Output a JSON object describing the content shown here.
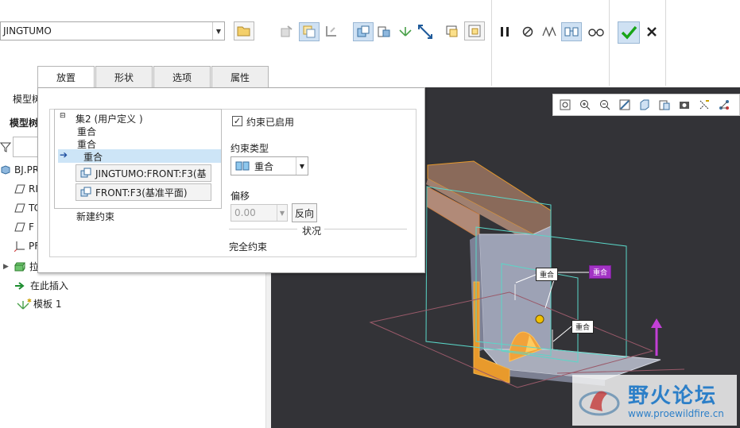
{
  "colors": {
    "accent_blue": "#2c7fc8",
    "viewport_bg": "#333337",
    "selection_bg": "#cde5f7",
    "orange_surface": "#e89a2c",
    "teal_outline": "#5ad7c8",
    "purple_tag": "#a233c4",
    "confirm_green": "#18a518"
  },
  "ribbon": {
    "template_combo": {
      "value": "JINGTUMO"
    },
    "icons": [
      "open-folder-icon",
      "component-interface-icon",
      "assembly-icon",
      "copy-placement-icon",
      "user-defined-icon",
      "package-icon",
      "mechanism-icon",
      "move-drag-icon",
      "show-component-icon",
      "separate-window-icon",
      "pause-icon",
      "cancel-circle-icon",
      "preview-icon",
      "check-glasses-icon",
      "view-glasses-icon",
      "confirm-check-icon",
      "close-x-icon"
    ]
  },
  "tabs": [
    {
      "label": "放置",
      "active": true
    },
    {
      "label": "形状",
      "active": false
    },
    {
      "label": "选项",
      "active": false
    },
    {
      "label": "属性",
      "active": false
    }
  ],
  "left_panel": {
    "header": "模型树",
    "subheader": "模型树",
    "items": [
      {
        "label": "BJ.PR",
        "icon": "part-icon"
      },
      {
        "label": "RI",
        "icon": "datum-plane-icon"
      },
      {
        "label": "TC",
        "icon": "datum-plane-icon"
      },
      {
        "label": "F",
        "icon": "datum-plane-icon"
      },
      {
        "label": "PF",
        "icon": "coordinate-system-icon"
      },
      {
        "label": "拉",
        "icon": "extrude-icon"
      },
      {
        "label": "在此插入",
        "icon": "insert-arrow-icon"
      },
      {
        "label": "模板 1",
        "icon": "template-icon"
      }
    ]
  },
  "placement": {
    "set_label": "集2 (用户定义 )",
    "constraints": [
      {
        "label": "重合"
      },
      {
        "label": "重合"
      },
      {
        "label": "重合",
        "selected": true
      }
    ],
    "references": [
      "JINGTUMO:FRONT:F3(基",
      "FRONT:F3(基准平面)"
    ],
    "new_constraint": "新建约束",
    "enabled_label": "约束已启用",
    "enabled_checked": true,
    "type_label": "约束类型",
    "type_value": "重合",
    "offset_label": "偏移",
    "offset_value": "0.00",
    "flip_label": "反向",
    "status_title": "状况",
    "status_value": "完全约束"
  },
  "viewport": {
    "tags": [
      "重合",
      "重合",
      "重合"
    ],
    "toolbar_icons": [
      "refit-icon",
      "zoom-in-icon",
      "zoom-out-icon",
      "repaint-icon",
      "display-style-icon",
      "saved-views-icon",
      "view-manager-icon",
      "datum-display-icon",
      "spin-center-icon"
    ]
  },
  "watermark": {
    "title": "野火论坛",
    "url": "www.proewildfire.cn"
  }
}
